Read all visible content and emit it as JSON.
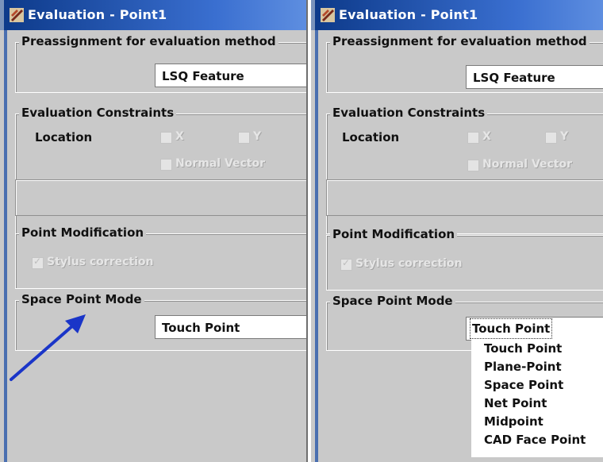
{
  "window": {
    "title": "Evaluation - Point1"
  },
  "preassignment": {
    "label": "Preassignment for evaluation method",
    "value": "LSQ Feature"
  },
  "constraints": {
    "label": "Evaluation Constraints",
    "location_label": "Location",
    "x_label": "X",
    "y_label": "Y",
    "normal_vector_label": "Normal Vector"
  },
  "modification": {
    "label": "Point Modification",
    "stylus_label": "Stylus correction",
    "stylus_checked": true
  },
  "space_point": {
    "label": "Space Point Mode",
    "value": "Touch Point",
    "options": [
      "Touch Point",
      "Plane-Point",
      "Space Point",
      "Net Point",
      "Midpoint",
      "CAD Face Point"
    ]
  },
  "icons": [
    "app-icon",
    "pointer-arrow-icon",
    "checkbox-icon"
  ],
  "colors": {
    "title_bar": "#0d3a8a",
    "dialog": "#c9c9c9",
    "arrow": "#1a35c8"
  }
}
